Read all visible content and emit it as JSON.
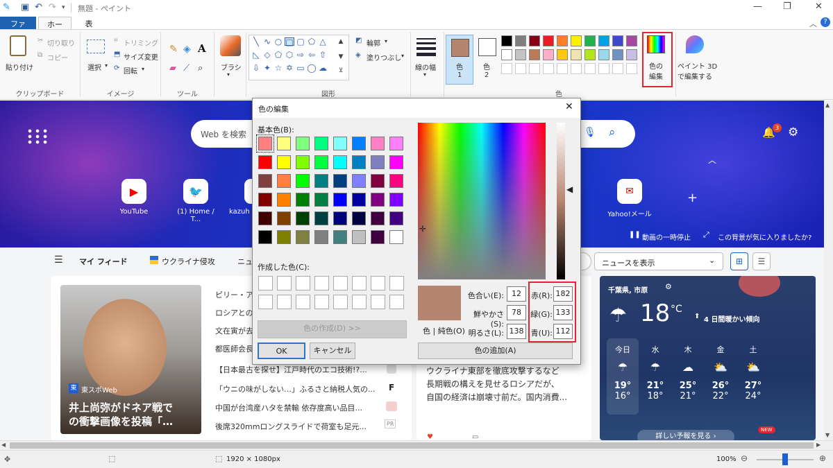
{
  "window": {
    "title": "無題 - ペイント",
    "quick_access": [
      "paint-app-icon",
      "save-icon",
      "undo-icon",
      "redo-icon",
      "customize-dropdown-icon"
    ]
  },
  "ribbon_tabs": [
    "ファイル",
    "ホーム",
    "表示"
  ],
  "ribbon": {
    "clipboard": {
      "paste": "貼り付け",
      "cut": "切り取り",
      "copy": "コピー",
      "label": "クリップボード"
    },
    "image": {
      "select": "選択",
      "crop": "トリミング",
      "resize": "サイズ変更",
      "rotate": "回転",
      "label": "イメージ"
    },
    "tools": {
      "label": "ツール",
      "brushes": "ブラシ"
    },
    "shapes": {
      "outline": "輪郭",
      "fill": "塗りつぶし",
      "label": "図形"
    },
    "size": {
      "label": "線の幅"
    },
    "colors": {
      "color1": "色\n1",
      "color1_a": "色",
      "color1_b": "1",
      "color2_a": "色",
      "color2_b": "2",
      "edit": "色の編集",
      "edit_a": "色の",
      "edit_b": "編集",
      "label": "色",
      "color1_value": "#b68570",
      "palette_row1": [
        "#000000",
        "#7f7f7f",
        "#880015",
        "#ed1c24",
        "#ff7f27",
        "#fff200",
        "#22b14c",
        "#00a2e8",
        "#3f48cc",
        "#a349a4"
      ],
      "palette_row2": [
        "#ffffff",
        "#c3c3c3",
        "#b97a57",
        "#ffaec9",
        "#ffc90e",
        "#efe4b0",
        "#b5e61d",
        "#99d9ea",
        "#7092be",
        "#c8bfe7"
      ]
    },
    "paint3d": {
      "a": "ペイント 3D",
      "b": "で編集する"
    }
  },
  "browser": {
    "search_placeholder": "Web を検索",
    "notification_count": "3",
    "shortcuts": [
      "YouTube",
      "(1) Home / T...",
      "kazuh",
      "Yahoo!メール"
    ],
    "pause_bg": "動画の一時停止",
    "like_bg": "この背景が気に入りましたか?",
    "feed_tabs": [
      "マイ フィード",
      "ウクライナ侵攻",
      "ニュ"
    ],
    "show_news": "ニュースを表示",
    "headline_source": "東スポWeb",
    "headline_1": "井上尚弥がドネア戦で",
    "headline_2": "の衝撃画像を投稿「…",
    "news_list": [
      "ピリー・ア",
      "ロシアとの",
      "文在寅が去",
      "都医師会長",
      "【日本最古を探せ】江戸時代のエコ技術!?...",
      "「ウニの味がしない…」ふるさと納税人気の...",
      "中国が台湾産ハタを禁輸 依存度高い品目...",
      "後席320mmロングスライドで荷室も足元..."
    ],
    "mid_article": [
      "ウクライナ東部を徹底攻撃するなど",
      "長期戦の構えを見せるロシアだが、",
      "自国の経済は崩壊寸前だ。国内消費..."
    ],
    "weather": {
      "location": "千葉県, 市原",
      "temp": "18",
      "unit": "°C",
      "trend": "4 日間暖かい傾向",
      "days": [
        "今日",
        "水",
        "木",
        "金",
        "土"
      ],
      "highs": [
        "19°",
        "21°",
        "25°",
        "26°",
        "27°"
      ],
      "lows": [
        "16°",
        "18°",
        "21°",
        "22°",
        "24°"
      ],
      "more": "詳しい予報を見る",
      "new_badge": "NEW"
    }
  },
  "status": {
    "size": "1920 × 1080px",
    "zoom": "100%"
  },
  "dialog": {
    "title": "色の編集",
    "basic_label": "基本色(B):",
    "custom_label": "作成した色(C):",
    "define": "色の作成(D) >>",
    "ok": "OK",
    "cancel": "キャンセル",
    "color_solid": "色 | 純色(O)",
    "add": "色の追加(A)",
    "hue_label": "色合い(E):",
    "sat_label": "鮮やかさ(S):",
    "lum_label": "明るさ(L):",
    "red_label": "赤(R):",
    "green_label": "緑(G):",
    "blue_label": "青(U):",
    "hue": "12",
    "sat": "78",
    "lum": "138",
    "red": "182",
    "green": "133",
    "blue": "112",
    "basic_colors": [
      "#ff8080",
      "#ffff80",
      "#80ff80",
      "#00ff80",
      "#80ffff",
      "#0080ff",
      "#ff80c0",
      "#ff80ff",
      "#ff0000",
      "#ffff00",
      "#80ff00",
      "#00ff40",
      "#00ffff",
      "#0080c0",
      "#8080c0",
      "#ff00ff",
      "#804040",
      "#ff8040",
      "#00ff00",
      "#008080",
      "#004080",
      "#8080ff",
      "#800040",
      "#ff0080",
      "#800000",
      "#ff8000",
      "#008000",
      "#008040",
      "#0000ff",
      "#0000a0",
      "#800080",
      "#8000ff",
      "#400000",
      "#804000",
      "#004000",
      "#004040",
      "#000080",
      "#000040",
      "#400040",
      "#400080",
      "#000000",
      "#808000",
      "#808040",
      "#808080",
      "#408080",
      "#c0c0c0",
      "#400040",
      "#ffffff"
    ]
  }
}
